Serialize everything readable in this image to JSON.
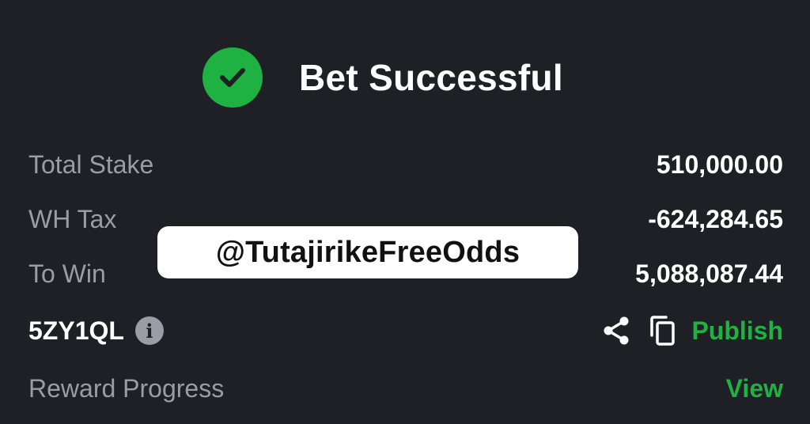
{
  "header": {
    "title": "Bet Successful",
    "status_icon": "check-circle-icon",
    "accent_color": "#1fb141"
  },
  "summary": {
    "total_stake_label": "Total Stake",
    "total_stake_value": "510,000.00",
    "wh_tax_label": "WH Tax",
    "wh_tax_value": "-624,284.65",
    "to_win_label": "To Win",
    "to_win_value": "5,088,087.44"
  },
  "booking": {
    "code": "5ZY1QL",
    "info_icon": "info-icon",
    "share_icon": "share-icon",
    "copy_icon": "copy-icon",
    "publish_label": "Publish"
  },
  "reward": {
    "label": "Reward Progress",
    "view_label": "View"
  },
  "watermark": {
    "text": "@TutajirikeFreeOdds"
  },
  "colors": {
    "background": "#1f2026",
    "muted_text": "#9a9ca6",
    "primary_text": "#ffffff",
    "link_green": "#1fb141"
  }
}
